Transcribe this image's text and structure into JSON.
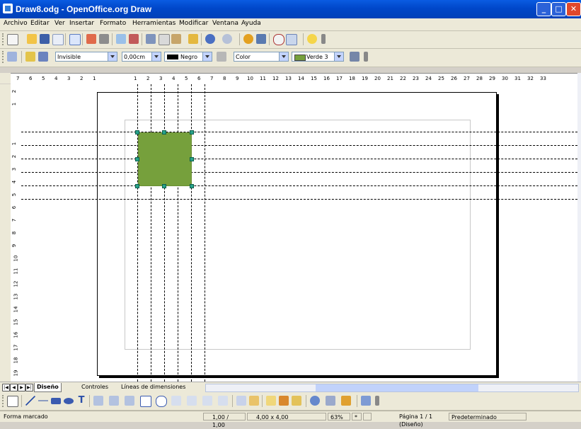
{
  "window": {
    "title": "Draw8.odg - OpenOffice.org Draw"
  },
  "menu": [
    "Archivo",
    "Editar",
    "Ver",
    "Insertar",
    "Formato",
    "Herramientas",
    "Modificar",
    "Ventana",
    "Ayuda"
  ],
  "line_toolbar": {
    "line_style": "Invisible",
    "line_width": "0,00cm",
    "line_color": "Negro",
    "area_style": "Color",
    "area_color": "Verde 3"
  },
  "colors": {
    "shape_fill": "#76a03c",
    "handles": "#2aa38a",
    "titlebar": "#0a5ce2"
  },
  "ruler": {
    "horizontal_ticks": [
      "7",
      "6",
      "5",
      "4",
      "3",
      "2",
      "1",
      "",
      "1",
      "2",
      "3",
      "4",
      "5",
      "6",
      "7",
      "8",
      "9",
      "10",
      "11",
      "12",
      "13",
      "14",
      "15",
      "16",
      "17",
      "18",
      "19",
      "20",
      "21",
      "22",
      "23",
      "24",
      "25",
      "26",
      "27",
      "28",
      "29",
      "30",
      "31",
      "32",
      "33"
    ],
    "vertical_ticks": [
      "2",
      "1",
      "",
      "1",
      "2",
      "3",
      "4",
      "5",
      "6",
      "7",
      "8",
      "9",
      "10",
      "11",
      "12",
      "13",
      "14",
      "15",
      "16",
      "17",
      "18",
      "19"
    ]
  },
  "tabs": [
    "Diseño",
    "Controles",
    "Líneas de dimensiones"
  ],
  "status": {
    "mode": "Forma marcado",
    "position": "1,00 / 1,00",
    "size": "4,00 x 4,00",
    "zoom": "63%",
    "modified": "*",
    "page": "Página 1 / 1 (Diseño)",
    "style": "Predeterminado"
  }
}
